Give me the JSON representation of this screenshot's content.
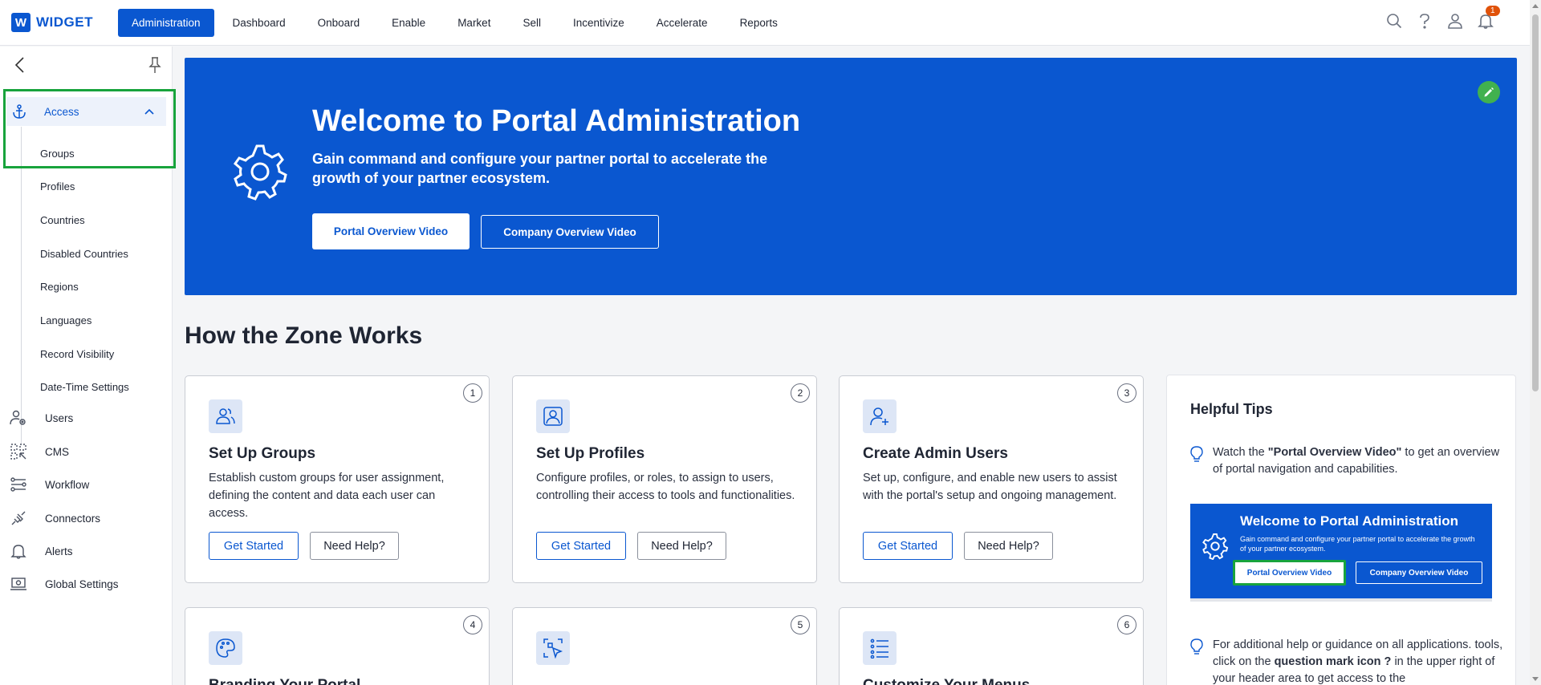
{
  "app": {
    "logo_letter": "W",
    "name": "WIDGET"
  },
  "nav": {
    "items": [
      {
        "label": "Administration",
        "active": true
      },
      {
        "label": "Dashboard"
      },
      {
        "label": "Onboard"
      },
      {
        "label": "Enable"
      },
      {
        "label": "Market"
      },
      {
        "label": "Sell"
      },
      {
        "label": "Incentivize"
      },
      {
        "label": "Accelerate"
      },
      {
        "label": "Reports"
      }
    ],
    "notification_count": "1",
    "icons": [
      "search-icon",
      "help-icon",
      "user-icon",
      "bell-icon"
    ]
  },
  "sidebar": {
    "access": {
      "label": "Access",
      "expanded": true,
      "sub_items": [
        "Groups",
        "Profiles",
        "Countries",
        "Disabled Countries",
        "Regions",
        "Languages",
        "Record Visibility",
        "Date-Time Settings"
      ]
    },
    "items": [
      {
        "label": "Users",
        "icon": "users-cog-icon"
      },
      {
        "label": "CMS",
        "icon": "cms-icon"
      },
      {
        "label": "Workflow",
        "icon": "workflow-icon"
      },
      {
        "label": "Connectors",
        "icon": "connectors-icon"
      },
      {
        "label": "Alerts",
        "icon": "bell-icon"
      },
      {
        "label": "Global Settings",
        "icon": "settings-laptop-icon"
      }
    ]
  },
  "hero": {
    "title": "Welcome to Portal Administration",
    "subtitle": "Gain command and configure your partner portal to accelerate the growth of your partner ecosystem.",
    "primary_button": "Portal Overview Video",
    "secondary_button": "Company Overview Video",
    "bg_color": "#0a57d0"
  },
  "section": {
    "title": "How the Zone Works"
  },
  "cards": [
    {
      "num": "1",
      "title": "Set Up Groups",
      "desc": "Establish custom groups for user assignment, defining the content and data each user can access.",
      "primary": "Get Started",
      "secondary": "Need Help?",
      "icon": "users-icon"
    },
    {
      "num": "2",
      "title": "Set Up Profiles",
      "desc": "Configure profiles, or roles, to assign to users, controlling their access to tools and functionalities.",
      "primary": "Get Started",
      "secondary": "Need Help?",
      "icon": "profile-icon"
    },
    {
      "num": "3",
      "title": "Create Admin Users",
      "desc": "Set up, configure, and enable new users to assist with the portal's setup and ongoing management.",
      "primary": "Get Started",
      "secondary": "Need Help?",
      "icon": "user-plus-icon"
    },
    {
      "num": "4",
      "title": "Branding Your Portal",
      "icon": "palette-icon"
    },
    {
      "num": "5",
      "title": "",
      "icon": "select-cursor-icon"
    },
    {
      "num": "6",
      "title": "Customize Your Menus",
      "icon": "list-icon"
    }
  ],
  "tips": {
    "title": "Helpful Tips",
    "tip1_pre": "Watch the ",
    "tip1_bold": "\"Portal Overview Video\"",
    "tip1_post": " to get an overview of portal navigation and capabilities.",
    "preview": {
      "title": "Welcome to Portal Administration",
      "subtitle": "Gain command and configure your partner portal to accelerate the growth of your partner ecosystem.",
      "btn1": "Portal Overview Video",
      "btn2": "Company Overview Video"
    },
    "tip2_pre": "For additional help or guidance on all applications. tools, click on the ",
    "tip2_bold": "question mark icon ?",
    "tip2_post": " in the upper right of your header area to get access to the"
  },
  "colors": {
    "accent": "#0a57d0",
    "highlight": "#18a33c",
    "badge": "#e0520a",
    "edit": "#41b14f"
  }
}
